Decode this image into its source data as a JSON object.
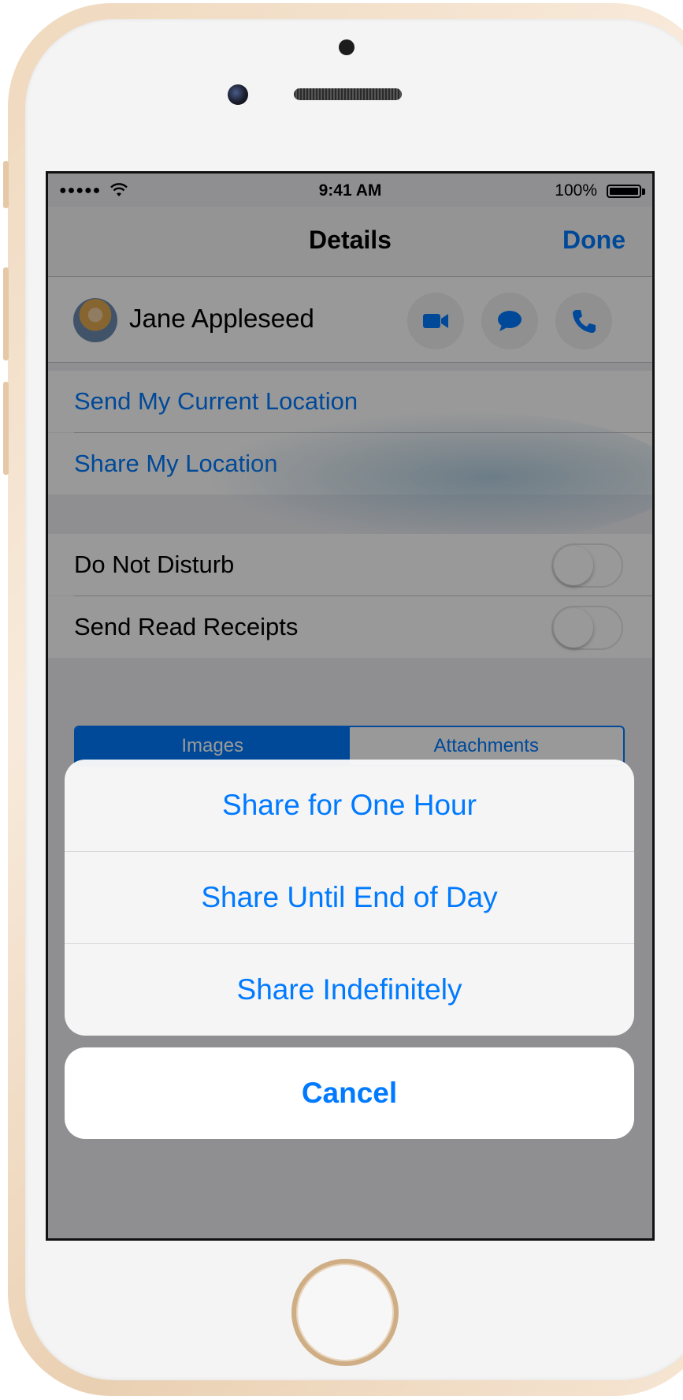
{
  "status_bar": {
    "signal": "●●●●●",
    "time": "9:41 AM",
    "battery_percent": "100%"
  },
  "nav": {
    "title": "Details",
    "done_label": "Done"
  },
  "contact": {
    "name": "Jane Appleseed",
    "actions": [
      "video-camera-icon",
      "message-bubble-icon",
      "phone-icon"
    ]
  },
  "location_section": {
    "items": [
      {
        "label": "Send My Current Location"
      },
      {
        "label": "Share My Location"
      }
    ]
  },
  "settings_section": {
    "items": [
      {
        "label": "Do Not Disturb",
        "toggle_on": false
      },
      {
        "label": "Send Read Receipts",
        "toggle_on": false
      }
    ]
  },
  "segmented_control": {
    "segments": [
      "Images",
      "Attachments"
    ],
    "selected": "Images"
  },
  "action_sheet": {
    "options": [
      "Share for One Hour",
      "Share Until End of Day",
      "Share Indefinitely"
    ],
    "cancel_label": "Cancel"
  },
  "colors": {
    "accent": "#007aff",
    "device_gold": "#e8cba8"
  }
}
